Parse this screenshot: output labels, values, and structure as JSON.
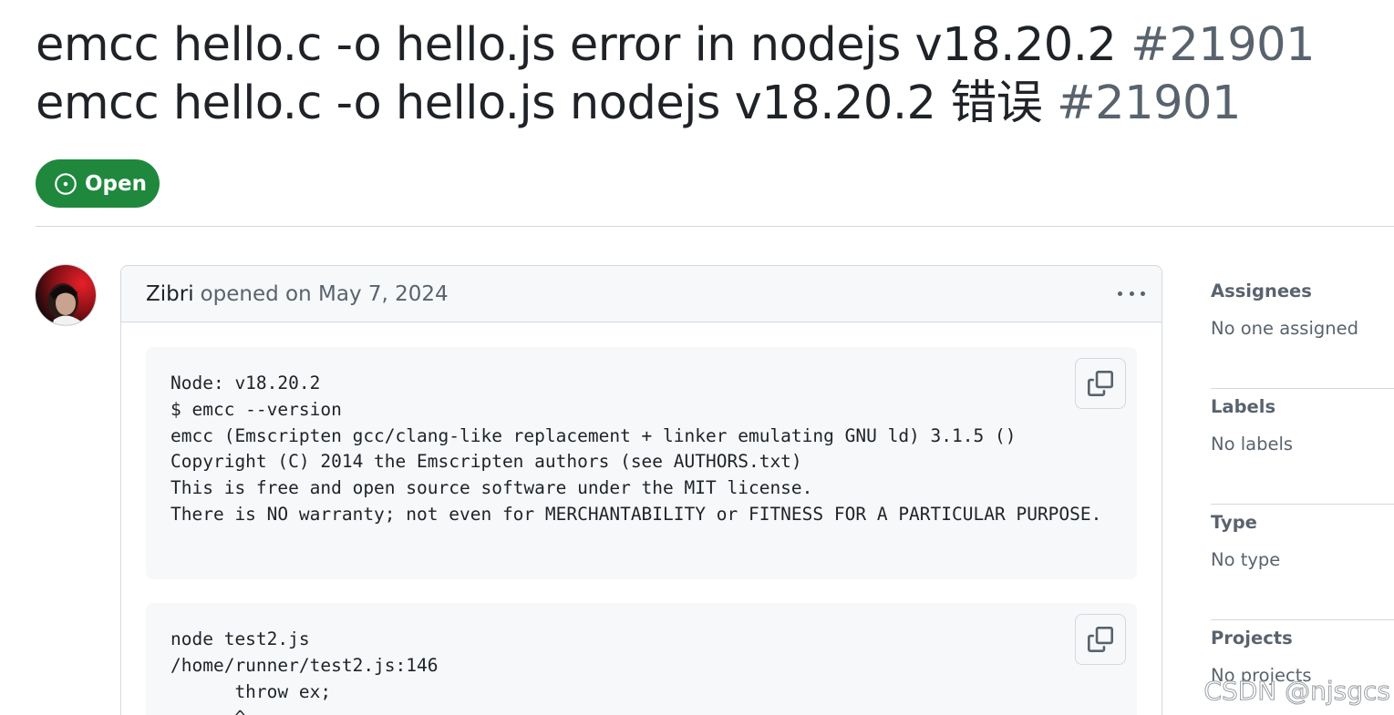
{
  "issue": {
    "title_en": "emcc hello.c -o hello.js error in nodejs v18.20.2",
    "title_zh": "emcc hello.c -o hello.js nodejs v18.20.2 错误",
    "number": "#21901",
    "state": "Open"
  },
  "comment": {
    "author": "Zibri",
    "meta": "opened on May 7, 2024",
    "code_blocks": [
      {
        "text": "Node: v18.20.2\n$ emcc --version\nemcc (Emscripten gcc/clang-like replacement + linker emulating GNU ld) 3.1.5 ()\nCopyright (C) 2014 the Emscripten authors (see AUTHORS.txt)\nThis is free and open source software under the MIT license.\nThere is NO warranty; not even for MERCHANTABILITY or FITNESS FOR A PARTICULAR PURPOSE."
      },
      {
        "text": "node test2.js\n/home/runner/test2.js:146\n      throw ex;\n      ^"
      }
    ]
  },
  "sidebar": {
    "sections": [
      {
        "title": "Assignees",
        "value": "No one assigned"
      },
      {
        "title": "Labels",
        "value": "No labels"
      },
      {
        "title": "Type",
        "value": "No type"
      },
      {
        "title": "Projects",
        "value": "No projects"
      }
    ]
  },
  "watermark": "CSDN @njsgcs",
  "icons": {
    "state": "issue-opened-icon",
    "copy": "copy-icon",
    "more": "kebab-horizontal-icon"
  },
  "colors": {
    "open_green": "#1f883d",
    "muted_text": "#59636e",
    "border": "#d1d9e0",
    "code_bg": "#f6f8fa"
  }
}
